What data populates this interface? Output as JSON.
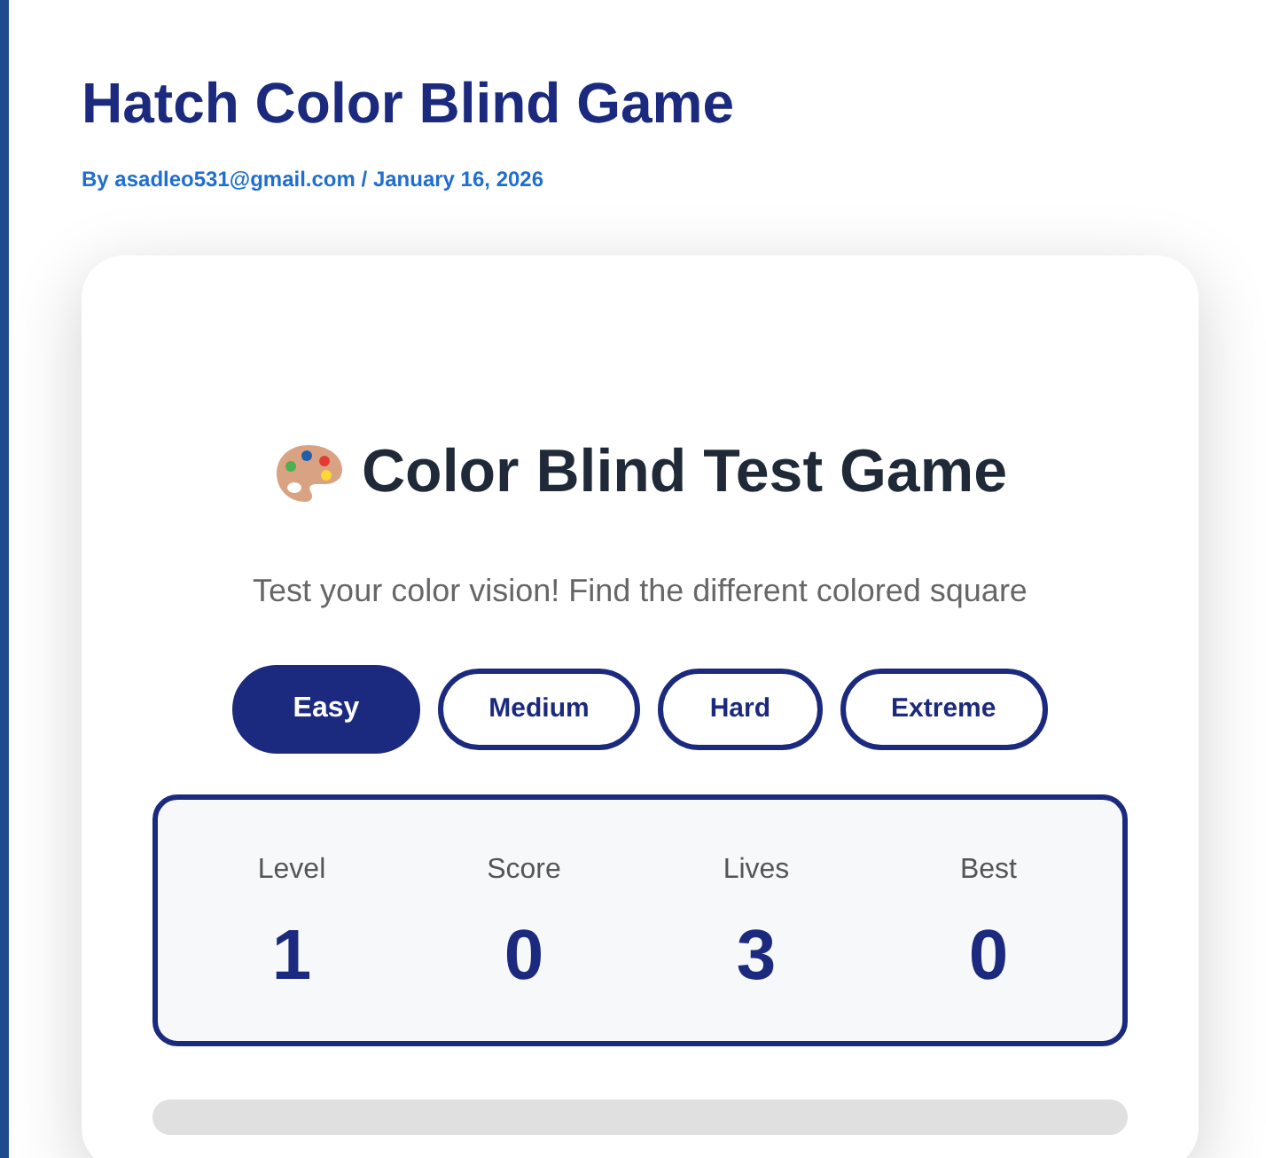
{
  "post": {
    "title": "Hatch Color Blind Game",
    "meta": "By asadleo531@gmail.com / January 16, 2026"
  },
  "game": {
    "title": "Color Blind Test Game",
    "subtitle": "Test your color vision! Find the different colored square",
    "difficulties": [
      {
        "label": "Easy",
        "selected": true
      },
      {
        "label": "Medium",
        "selected": false
      },
      {
        "label": "Hard",
        "selected": false
      },
      {
        "label": "Extreme",
        "selected": false
      }
    ],
    "stats": [
      {
        "label": "Level",
        "value": "1"
      },
      {
        "label": "Score",
        "value": "0"
      },
      {
        "label": "Lives",
        "value": "3"
      },
      {
        "label": "Best",
        "value": "0"
      }
    ],
    "progress": {
      "level": 0
    }
  }
}
